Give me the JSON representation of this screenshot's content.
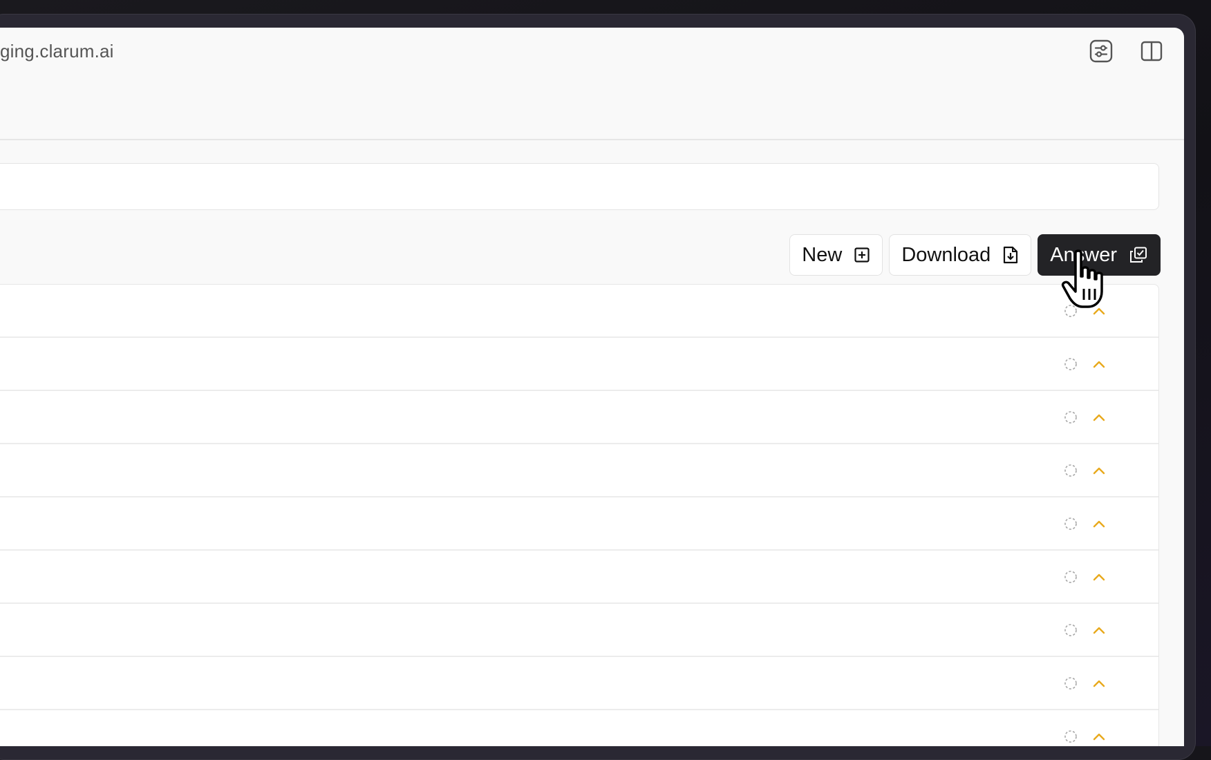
{
  "browser": {
    "url_fragment": "ging.clarum.ai",
    "icons": [
      "sliders-icon",
      "sidebar-toggle-icon"
    ]
  },
  "toolbar": {
    "new_label": "New",
    "download_label": "Download",
    "answer_label": "Answer"
  },
  "list": {
    "row_count": 9,
    "status_icon": "dashed-circle-icon",
    "expand_icon": "chevron-up-icon",
    "accent_color": "#e8a91c"
  },
  "colors": {
    "primary_button": "#232326",
    "background": "#f9f9f9"
  }
}
